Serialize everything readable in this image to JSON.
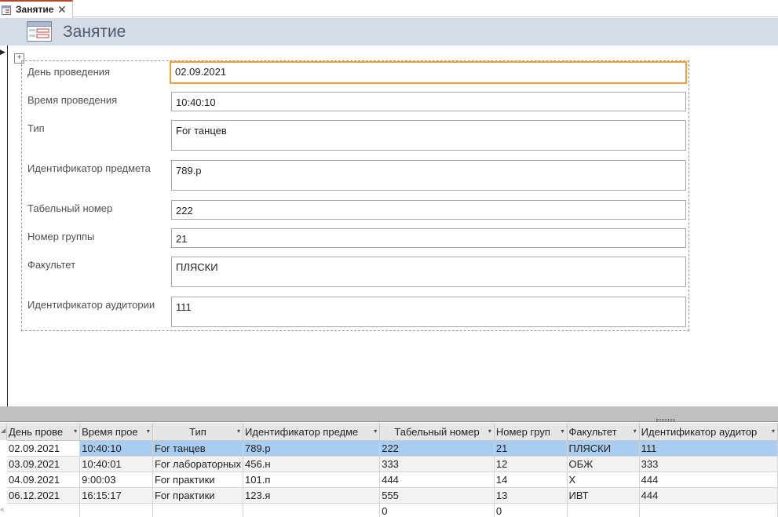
{
  "tab": {
    "label": "Занятие",
    "close_glyph": "✕",
    "icon": "form-icon"
  },
  "header": {
    "title": "Занятие",
    "icon": "form-icon"
  },
  "form": {
    "fields": [
      {
        "label": "День проведения",
        "value": "02.09.2021"
      },
      {
        "label": "Время проведения",
        "value": "10:40:10"
      },
      {
        "label": "Тип",
        "value": "For танцев"
      },
      {
        "label": "Идентификатор предмета",
        "value": "789.р"
      },
      {
        "label": "Табельный номер",
        "value": "222"
      },
      {
        "label": "Номер группы",
        "value": "21"
      },
      {
        "label": "Факультет",
        "value": "ПЛЯСКИ"
      },
      {
        "label": "Идентификатор аудитории",
        "value": "111"
      }
    ]
  },
  "datasheet": {
    "columns": [
      "День прове",
      "Время прое",
      "Тип",
      "Идентификатор предме",
      "Табельный номер",
      "Номер груп",
      "Факультет",
      "Идентификатор аудитор"
    ],
    "rows": [
      [
        "02.09.2021",
        "10:40:10",
        "For танцев",
        "789.р",
        "222",
        "21",
        "ПЛЯСКИ",
        "111"
      ],
      [
        "03.09.2021",
        "10:40:01",
        "For лабораторных",
        "456.н",
        "333",
        "12",
        "ОБЖ",
        "333"
      ],
      [
        "04.09.2021",
        "9:00:03",
        "For практики",
        "101.п",
        "444",
        "14",
        "Х",
        "444"
      ],
      [
        "06.12.2021",
        "16:15:17",
        "For практики",
        "123.я",
        "555",
        "13",
        "ИВТ",
        "444"
      ],
      [
        "",
        "",
        "",
        "",
        "0",
        "0",
        "",
        ""
      ]
    ],
    "selected_row": 0
  },
  "colors": {
    "accent": "#b7472a",
    "focus": "#f0a030",
    "header_bg": "#d6dce5",
    "selection": "#a9cdf0"
  }
}
